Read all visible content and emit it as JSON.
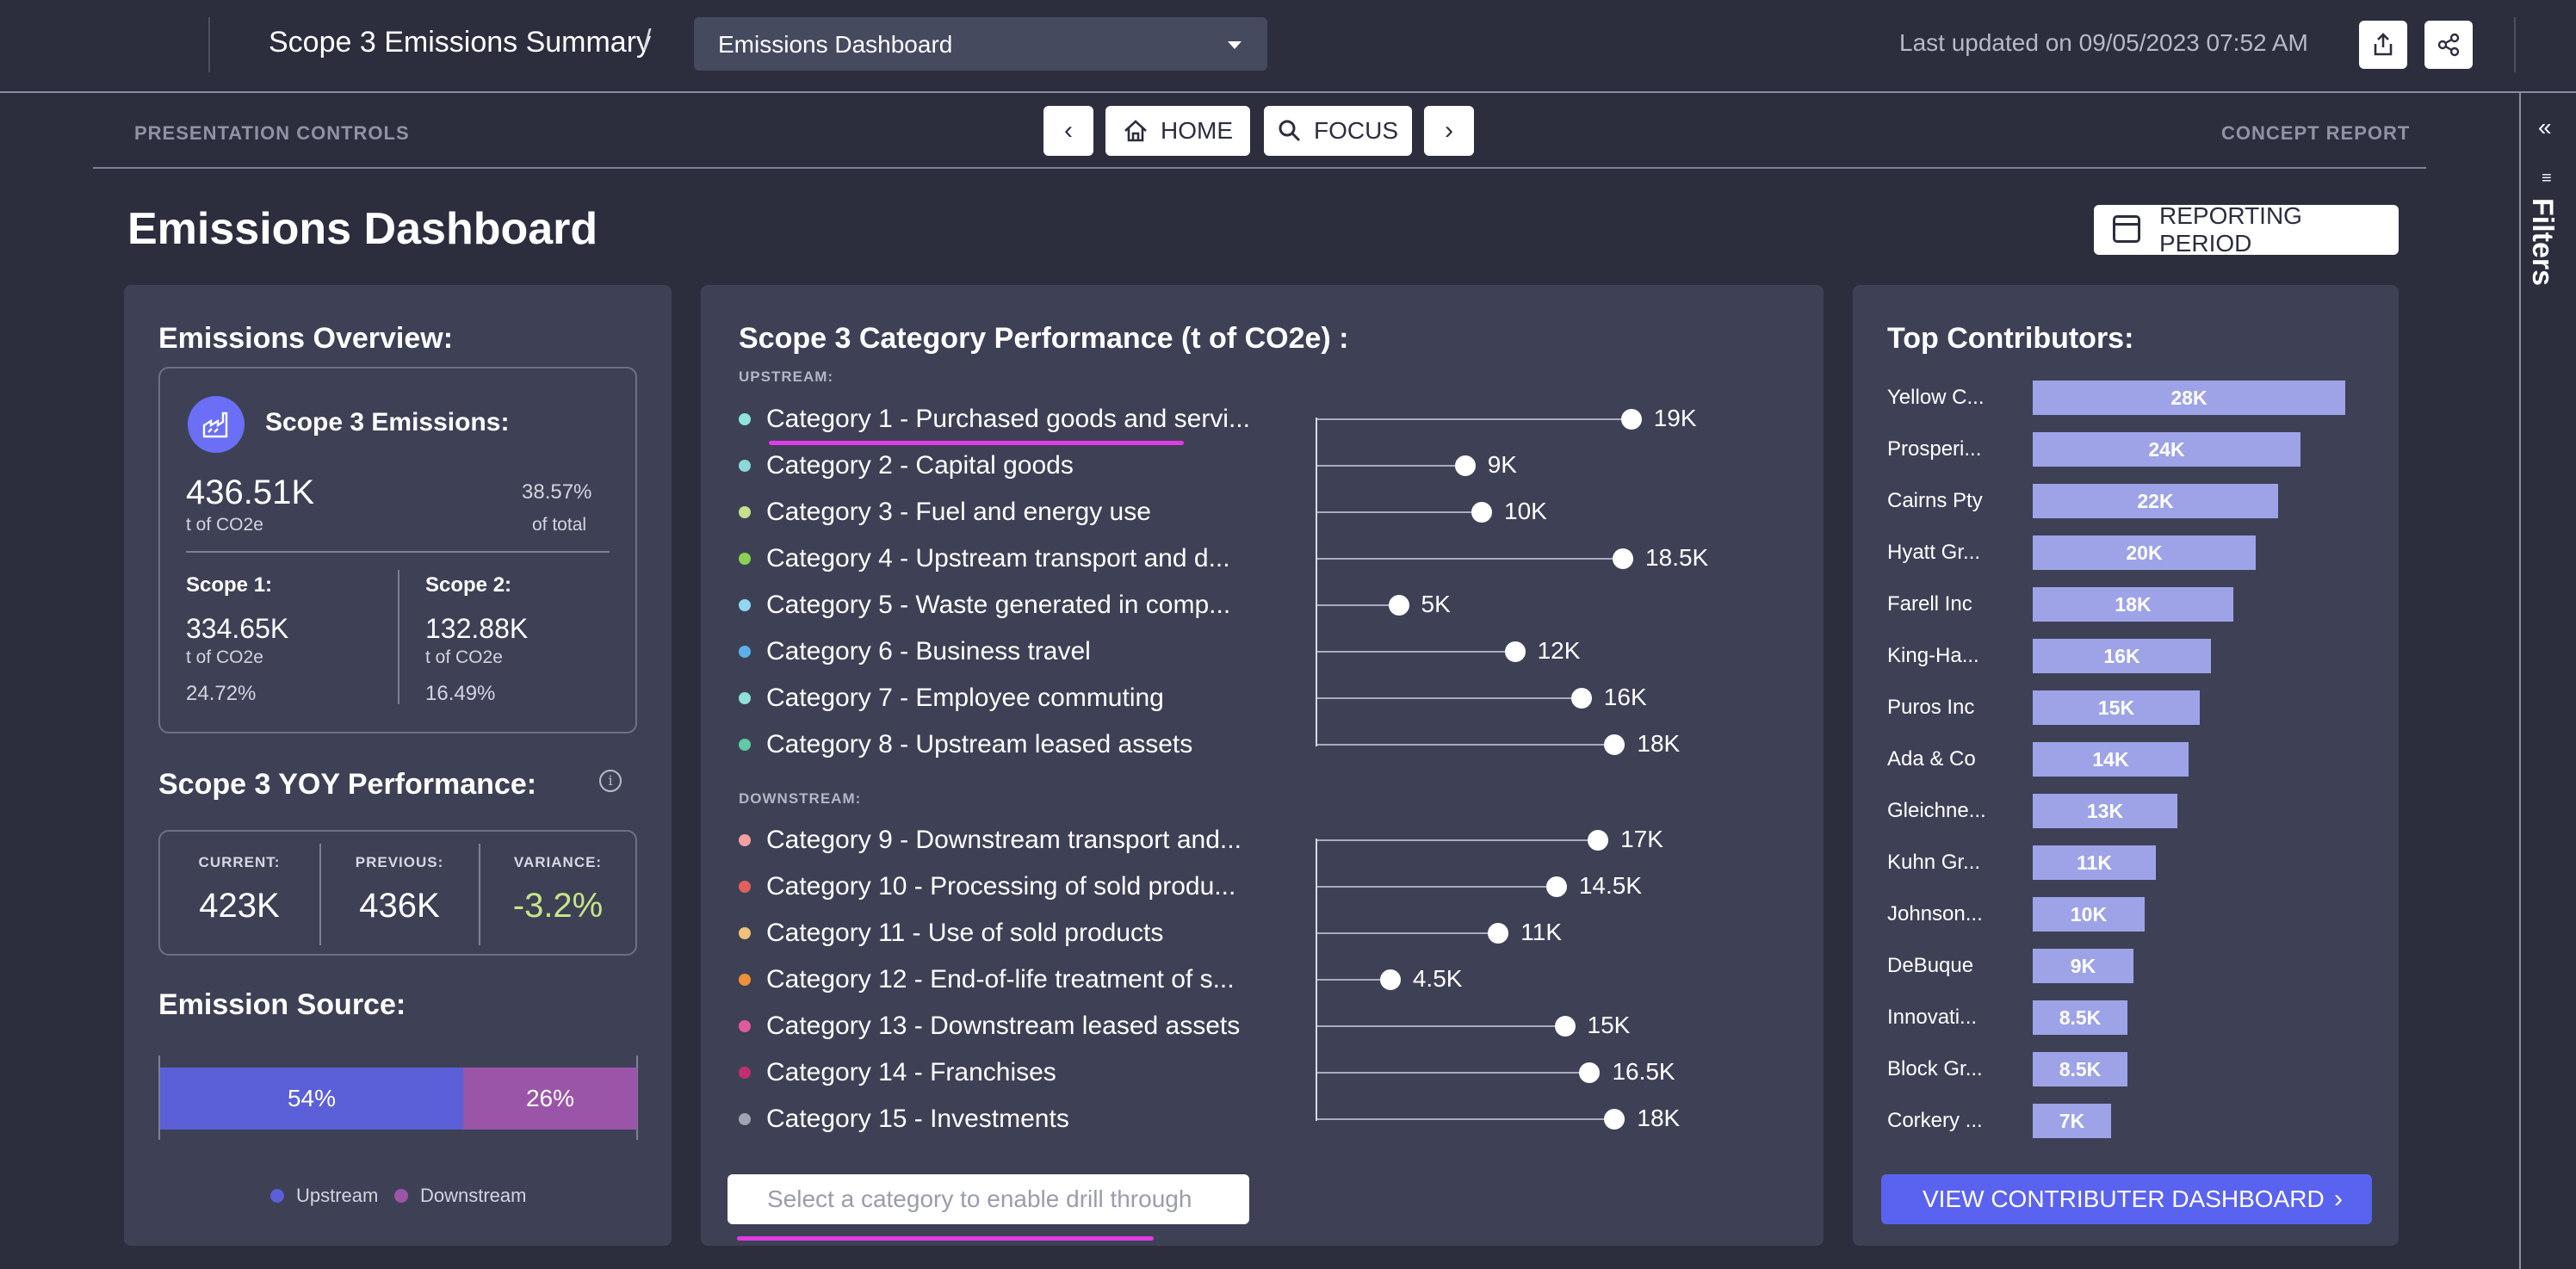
{
  "header": {
    "breadcrumb_title": "Scope 3 Emissions Summary",
    "separator": "/",
    "dashboard_select": "Emissions Dashboard",
    "last_updated": "Last updated on 09/05/2023 07:52 AM",
    "export_icon": "export-icon",
    "share_icon": "share-icon"
  },
  "controls": {
    "left_label": "PRESENTATION CONTROLS",
    "right_label": "CONCEPT REPORT",
    "home": "HOME",
    "focus": "FOCUS",
    "prev_icon": "chevron-left-icon",
    "next_icon": "chevron-right-icon"
  },
  "rail": {
    "label": "Filters",
    "collapse_icon": "double-chevron-left-icon",
    "filter_icon": "filter-icon"
  },
  "page": {
    "title": "Emissions Dashboard",
    "reporting_period": "REPORTING PERIOD"
  },
  "overview": {
    "title": "Emissions Overview:",
    "scope3_label": "Scope 3 Emissions:",
    "scope3_value": "436.51K",
    "scope3_unit": "t of CO2e",
    "scope3_pct": "38.57%",
    "scope3_pct_label": "of total",
    "scope1_label": "Scope 1:",
    "scope1_value": "334.65K",
    "scope1_unit": "t of CO2e",
    "scope1_pct": "24.72%",
    "scope2_label": "Scope 2:",
    "scope2_value": "132.88K",
    "scope2_unit": "t of CO2e",
    "scope2_pct": "16.49%"
  },
  "yoy": {
    "title": "Scope 3 YOY Performance:",
    "current_label": "CURRENT:",
    "current_value": "423K",
    "previous_label": "PREVIOUS:",
    "previous_value": "436K",
    "variance_label": "VARIANCE:",
    "variance_value": "-3.2%",
    "variance_color": "#c5e58a"
  },
  "source": {
    "title": "Emission Source:",
    "upstream_pct": "54%",
    "downstream_pct": "26%",
    "upstream_label": "Upstream",
    "downstream_label": "Downstream",
    "upstream_color": "#5b5fd8",
    "downstream_color": "#9a55a8"
  },
  "categories": {
    "title": "Scope 3 Category Performance (t of CO2e) :",
    "upstream_label": "UPSTREAM:",
    "downstream_label": "DOWNSTREAM:",
    "drill_placeholder": "Select a category to enable drill through",
    "upstream": [
      {
        "name": "Category 1 - Purchased goods and servi...",
        "value": 19000,
        "label": "19K",
        "color": "#8fe3df"
      },
      {
        "name": "Category 2 - Capital goods",
        "value": 9000,
        "label": "9K",
        "color": "#8cd7d8"
      },
      {
        "name": "Category 3 - Fuel and energy use",
        "value": 10000,
        "label": "10K",
        "color": "#c6e08d"
      },
      {
        "name": "Category 4 - Upstream transport and d...",
        "value": 18500,
        "label": "18.5K",
        "color": "#8bcf55"
      },
      {
        "name": "Category 5 - Waste generated in comp...",
        "value": 5000,
        "label": "5K",
        "color": "#92d6f2"
      },
      {
        "name": "Category 6 - Business travel",
        "value": 12000,
        "label": "12K",
        "color": "#5bb1e6"
      },
      {
        "name": "Category 7 - Employee commuting",
        "value": 16000,
        "label": "16K",
        "color": "#8fe0d8"
      },
      {
        "name": "Category 8 - Upstream leased assets",
        "value": 18000,
        "label": "18K",
        "color": "#63c9a3"
      }
    ],
    "downstream": [
      {
        "name": "Category 9 - Downstream transport and...",
        "value": 17000,
        "label": "17K",
        "color": "#f2a0a0"
      },
      {
        "name": "Category 10 - Processing of sold produ...",
        "value": 14500,
        "label": "14.5K",
        "color": "#e0605e"
      },
      {
        "name": "Category 11 - Use of sold products",
        "value": 11000,
        "label": "11K",
        "color": "#f2c27a"
      },
      {
        "name": "Category 12 - End-of-life treatment of s...",
        "value": 4500,
        "label": "4.5K",
        "color": "#f0903a"
      },
      {
        "name": "Category 13 - Downstream leased assets",
        "value": 15000,
        "label": "15K",
        "color": "#e05aa0"
      },
      {
        "name": "Category 14 - Franchises",
        "value": 16500,
        "label": "16.5K",
        "color": "#c1306e"
      },
      {
        "name": "Category 15 - Investments",
        "value": 18000,
        "label": "18K",
        "color": "#a0a3b0"
      }
    ]
  },
  "contributors": {
    "title": "Top Contributors:",
    "button": "VIEW CONTRIBUTER DASHBOARD",
    "items": [
      {
        "name": "Yellow C...",
        "value": 28000,
        "label": "28K"
      },
      {
        "name": "Prosperi...",
        "value": 24000,
        "label": "24K"
      },
      {
        "name": "Cairns Pty",
        "value": 22000,
        "label": "22K"
      },
      {
        "name": "Hyatt Gr...",
        "value": 20000,
        "label": "20K"
      },
      {
        "name": "Farell Inc",
        "value": 18000,
        "label": "18K"
      },
      {
        "name": "King-Ha...",
        "value": 16000,
        "label": "16K"
      },
      {
        "name": "Puros Inc",
        "value": 15000,
        "label": "15K"
      },
      {
        "name": "Ada & Co",
        "value": 14000,
        "label": "14K"
      },
      {
        "name": "Gleichne...",
        "value": 13000,
        "label": "13K"
      },
      {
        "name": "Kuhn Gr...",
        "value": 11000,
        "label": "11K"
      },
      {
        "name": "Johnson...",
        "value": 10000,
        "label": "10K"
      },
      {
        "name": "DeBuque",
        "value": 9000,
        "label": "9K"
      },
      {
        "name": "Innovati...",
        "value": 8500,
        "label": "8.5K"
      },
      {
        "name": "Block Gr...",
        "value": 8500,
        "label": "8.5K"
      },
      {
        "name": "Corkery ...",
        "value": 7000,
        "label": "7K"
      }
    ]
  }
}
